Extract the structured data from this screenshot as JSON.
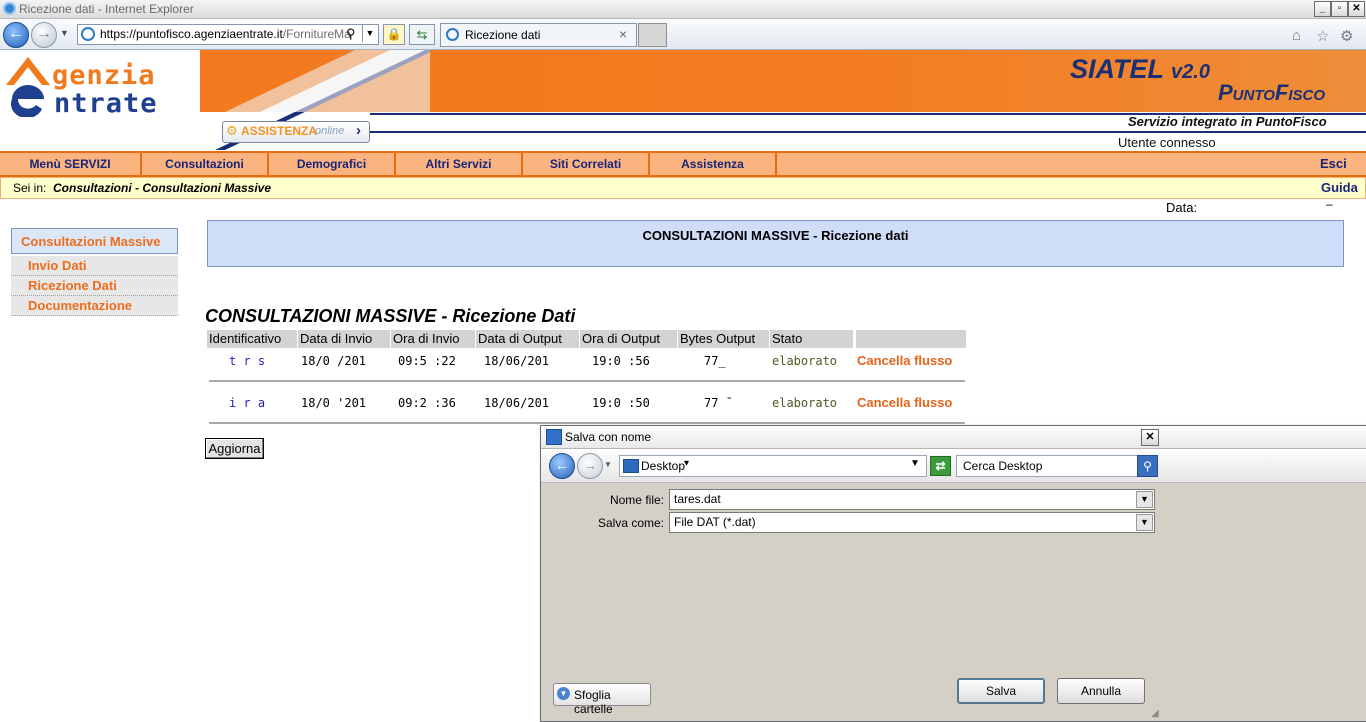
{
  "browser": {
    "window_title": "Ricezione dati - Internet Explorer",
    "url_host": "https://puntofisco.agenziaentrate.it",
    "url_path": "/FornitureMass",
    "tab_title": "Ricezione dati",
    "tab_close": "×",
    "controls": {
      "minimize": "_",
      "maximize": "▫",
      "close": "✕"
    },
    "icons": {
      "home": "home-icon",
      "favorites": "star-icon",
      "tools": "gear-icon"
    }
  },
  "header": {
    "logo_top": "genzia",
    "logo_bottom": "ntrate",
    "siatel": "SIATEL",
    "version": "v2.0",
    "product": "PuntoFisco",
    "assistenza": "ASSISTENZA",
    "assistenza_online": "online",
    "servizio": "Servizio integrato in PuntoFisco",
    "utente": "Utente connesso"
  },
  "menu": {
    "items": [
      "Menù SERVIZI",
      "Consultazioni",
      "Demografici",
      "Altri Servizi",
      "Siti Correlati",
      "Assistenza"
    ],
    "esci": "Esci"
  },
  "breadcrumb": {
    "prefix": "Sei in:",
    "path": "Consultazioni - Consultazioni Massive",
    "guida": "Guida"
  },
  "date": {
    "label": "Data:",
    "value": "–"
  },
  "sidebar": {
    "title": "Consultazioni Massive",
    "items": [
      "Invio Dati",
      "Ricezione Dati",
      "Documentazione"
    ]
  },
  "main": {
    "panel_title": "CONSULTAZIONI MASSIVE - Ricezione dati",
    "heading": "CONSULTAZIONI MASSIVE - Ricezione Dati",
    "refresh_button": "Aggiorna"
  },
  "table": {
    "headers": [
      "Identificativo",
      "Data di Invio",
      "Ora di Invio",
      "Data di Output",
      "Ora di Output",
      "Bytes Output",
      "Stato"
    ],
    "rows": [
      {
        "id": "t r s",
        "data_invio": "18/0 /201",
        "ora_invio": "09:5 :22",
        "data_output": "18/06/201",
        "ora_output": "19:0 :56",
        "bytes": "77_",
        "stato": "elaborato",
        "action": "Cancella flusso"
      },
      {
        "id": "i r a",
        "data_invio": "18/0 '201",
        "ora_invio": "09:2 :36",
        "data_output": "18/06/201",
        "ora_output": "19:0 :50",
        "bytes": "77 ¯",
        "stato": "elaborato",
        "action": "Cancella flusso"
      }
    ]
  },
  "dialog": {
    "title": "Salva con nome",
    "location": "Desktop",
    "search_placeholder": "Cerca Desktop",
    "filename_label": "Nome file:",
    "filename_value": "tares.dat",
    "type_label": "Salva come:",
    "type_value": "File DAT (*.dat)",
    "browse_folders": "Sfoglia cartelle",
    "save_button": "Salva",
    "cancel_button": "Annulla",
    "close": "✕"
  }
}
